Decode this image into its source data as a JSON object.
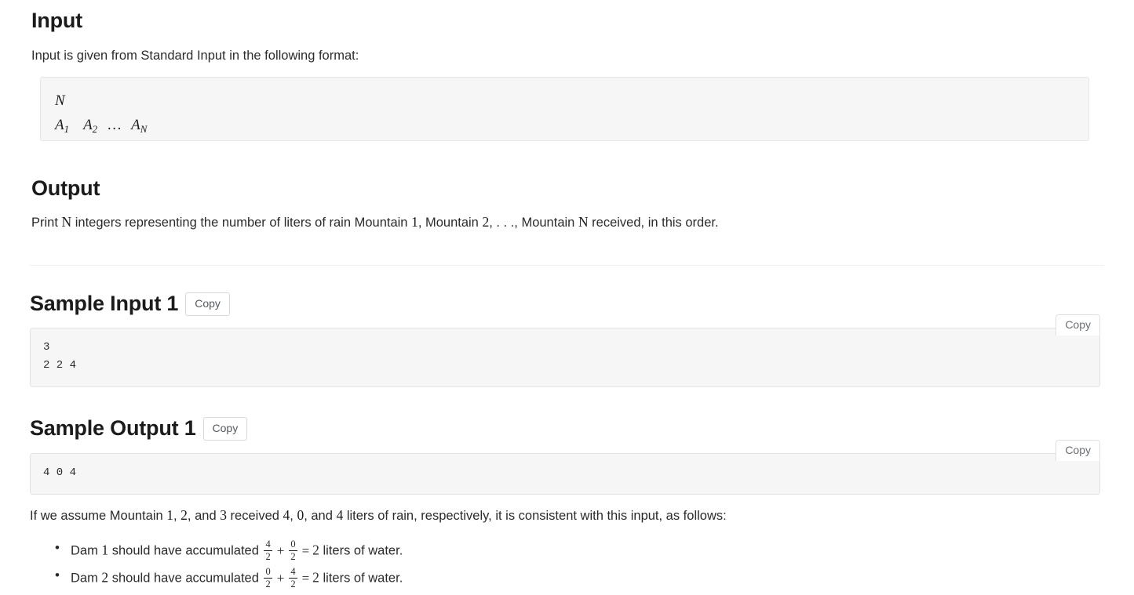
{
  "sections": {
    "input": {
      "heading": "Input",
      "description": "Input is given from Standard Input in the following format:",
      "format": {
        "line1": "N",
        "line2_a1": "A",
        "line2_a1_sub": "1",
        "line2_a2": "A",
        "line2_a2_sub": "2",
        "line2_dots": "…",
        "line2_an": "A",
        "line2_an_sub": "N"
      }
    },
    "output": {
      "heading": "Output",
      "description_part1": "Print ",
      "description_var1": "N",
      "description_part2": " integers representing the number of liters of rain Mountain ",
      "description_num1": "1",
      "description_part3": ", Mountain ",
      "description_num2": "2",
      "description_part4": ", . . ., Mountain ",
      "description_var2": "N",
      "description_part5": " received, in this order."
    },
    "sample_input_1": {
      "heading": "Sample Input 1",
      "copy_label": "Copy",
      "inline_copy_label": "Copy",
      "content": "3\n2 2 4"
    },
    "sample_output_1": {
      "heading": "Sample Output 1",
      "copy_label": "Copy",
      "inline_copy_label": "Copy",
      "content": "4 0 4"
    },
    "explanation": {
      "intro_part1": "If we assume Mountain ",
      "intro_num1": "1",
      "intro_part2": ", ",
      "intro_num2": "2",
      "intro_part3": ", and ",
      "intro_num3": "3",
      "intro_part4": " received ",
      "intro_num4": "4",
      "intro_part5": ", ",
      "intro_num5": "0",
      "intro_part6": ", and ",
      "intro_num6": "4",
      "intro_part7": " liters of rain, respectively, it is consistent with this input, as follows:",
      "bullets": [
        {
          "prefix": "Dam ",
          "index": "1",
          "middle": " should have accumulated ",
          "frac1_num": "4",
          "frac1_den": "2",
          "operator": "+",
          "frac2_num": "0",
          "frac2_den": "2",
          "equals": "=",
          "result": "2",
          "suffix": " liters of water."
        },
        {
          "prefix": "Dam ",
          "index": "2",
          "middle": " should have accumulated ",
          "frac1_num": "0",
          "frac1_den": "2",
          "operator": "+",
          "frac2_num": "4",
          "frac2_den": "2",
          "equals": "=",
          "result": "2",
          "suffix": " liters of water."
        }
      ]
    }
  },
  "colors": {
    "heading": "#1b1b1b",
    "body_text": "#2b2b2b",
    "code_background": "#f6f6f6",
    "code_border": "#e6e6e6",
    "divider": "#f0f0f0",
    "button_text": "#555a60"
  }
}
